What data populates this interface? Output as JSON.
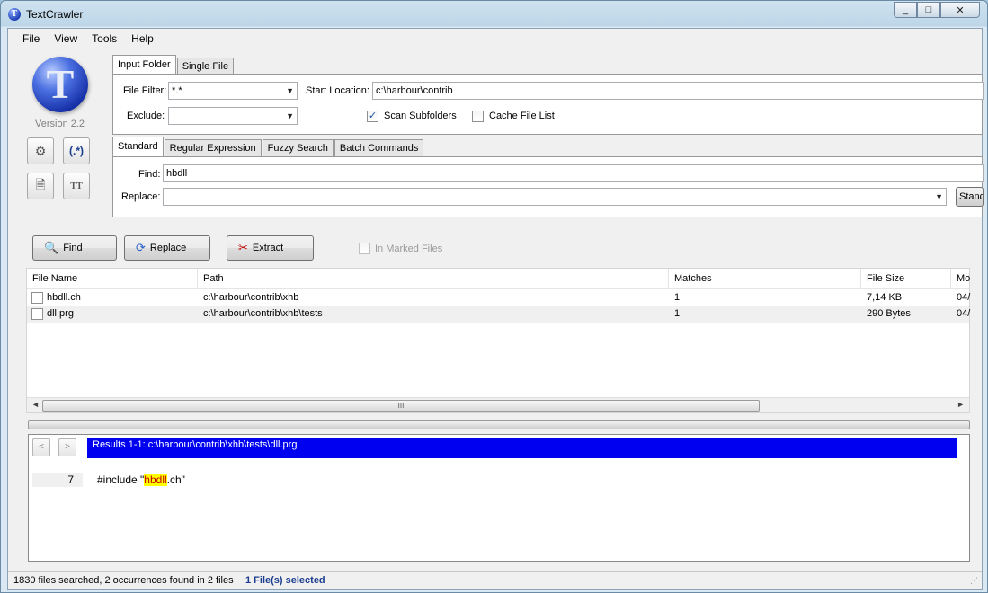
{
  "window": {
    "title": "TextCrawler",
    "controls": [
      "_",
      "□",
      "✕"
    ]
  },
  "menu": [
    "File",
    "View",
    "Tools",
    "Help"
  ],
  "sidebar": {
    "logo_letter": "T",
    "version": "Version 2.2"
  },
  "input_tabs": [
    "Input Folder",
    "Single File"
  ],
  "input": {
    "file_filter_label": "File Filter:",
    "file_filter_value": "*.*",
    "exclude_label": "Exclude:",
    "exclude_value": "",
    "start_location_label": "Start Location:",
    "start_location_value": "c:\\harbour\\contrib",
    "scan_subfolders_label": "Scan Subfolders",
    "scan_subfolders_checked": true,
    "cache_file_list_label": "Cache File List",
    "cache_file_list_checked": false
  },
  "search_tabs": [
    "Standard",
    "Regular Expression",
    "Fuzzy Search",
    "Batch Commands"
  ],
  "search": {
    "find_label": "Find:",
    "find_value": "hbdll",
    "replace_label": "Replace:",
    "replace_value": "",
    "mode_button": "Stand"
  },
  "actions": {
    "find": "Find",
    "replace": "Replace",
    "extract": "Extract",
    "in_marked_files": "In Marked Files"
  },
  "table": {
    "columns": [
      "File Name",
      "Path",
      "Matches",
      "File Size",
      "Mo"
    ],
    "rows": [
      {
        "name": "hbdll.ch",
        "path": "c:\\harbour\\contrib\\xhb",
        "matches": "1",
        "size": "7,14 KB",
        "mod": "04/"
      },
      {
        "name": "dll.prg",
        "path": "c:\\harbour\\contrib\\xhb\\tests",
        "matches": "1",
        "size": "290 Bytes",
        "mod": "04/"
      }
    ],
    "scroll_grip": "III"
  },
  "preview": {
    "prev": "<",
    "next": ">",
    "results_header": "Results 1-1: c:\\harbour\\contrib\\xhb\\tests\\dll.prg",
    "line_number": "7",
    "code_before": "#include \"",
    "code_match": "hbdll",
    "code_after": ".ch\""
  },
  "status": {
    "summary": "1830 files searched, 2 occurrences found in 2 files",
    "selected": "1 File(s) selected"
  }
}
